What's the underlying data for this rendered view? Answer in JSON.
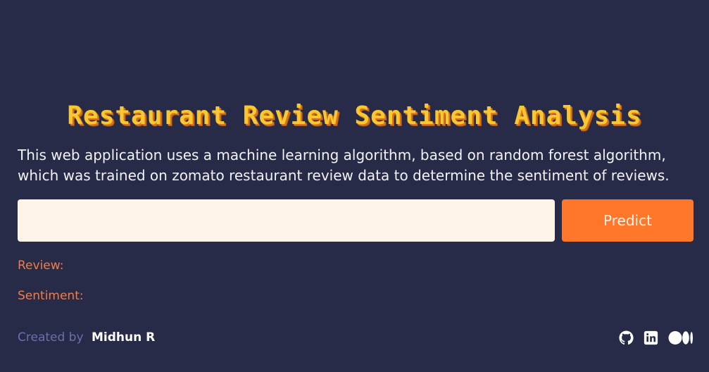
{
  "header": {
    "title": "Restaurant Review Sentiment Analysis"
  },
  "main": {
    "description": "This web application uses a machine learning algorithm, based on random forest algorithm, which was trained on zomato restaurant review data to determine the sentiment of reviews.",
    "input": {
      "value": "",
      "placeholder": ""
    },
    "predict_label": "Predict",
    "review_label": "Review:",
    "sentiment_label": "Sentiment:"
  },
  "footer": {
    "created_by": "Created by",
    "author": "Midhun R",
    "social_icons": [
      "github-icon",
      "linkedin-icon",
      "medium-icon"
    ]
  },
  "colors": {
    "background": "#272b48",
    "accent": "#ff772b",
    "title": "#f7c832",
    "input_background": "#fff4e7",
    "result_label": "#f07d4b"
  }
}
